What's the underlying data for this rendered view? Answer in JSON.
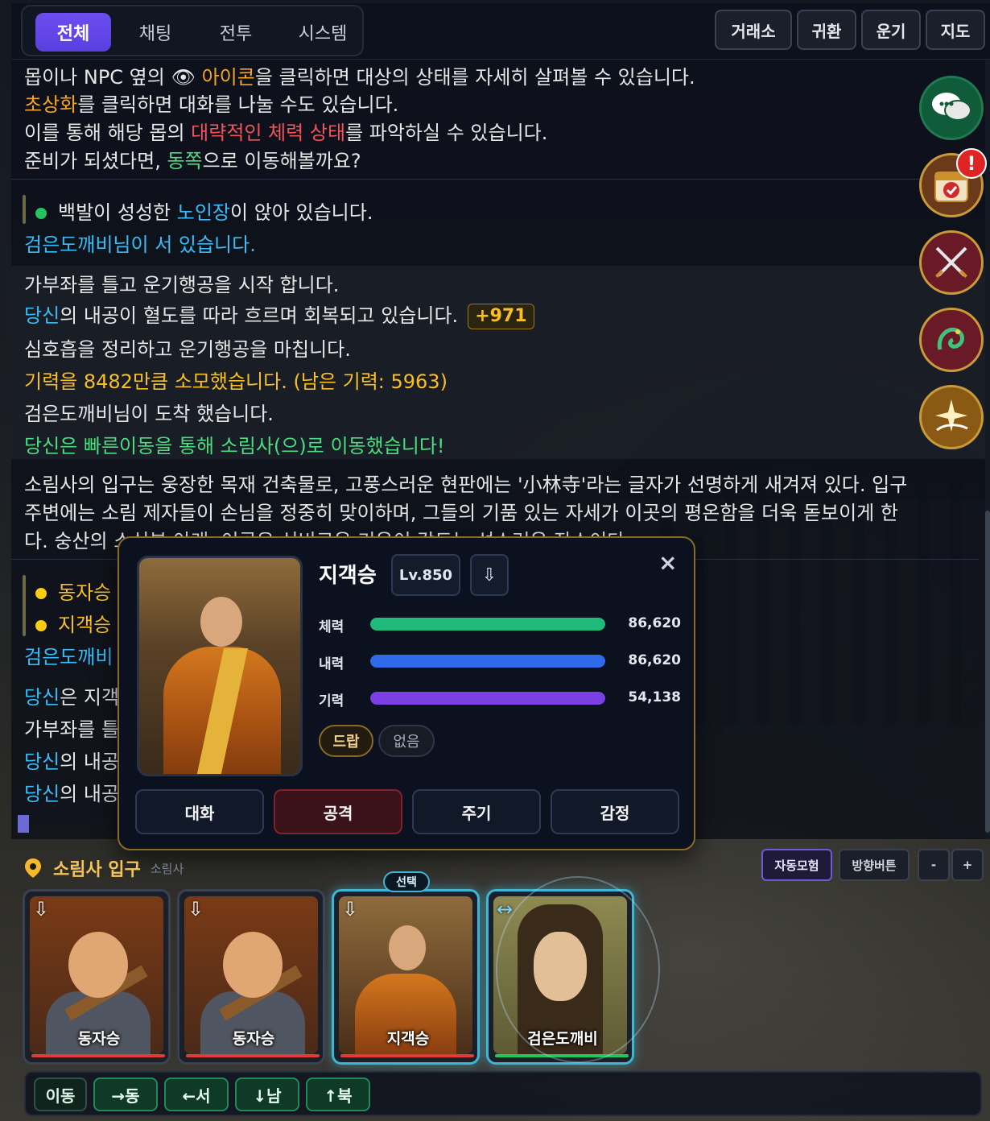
{
  "tabs": [
    "전체",
    "채팅",
    "전투",
    "시스템"
  ],
  "top_buttons": [
    "거래소",
    "귀환",
    "운기",
    "지도"
  ],
  "log": {
    "l1_pre": "몹이나 NPC 옆의 ",
    "l1_eye": "👁",
    "l1_hl": "아이콘",
    "l1_post": "을 클릭하면 대상의 상태를 자세히 살펴볼 수 있습니다.",
    "l2_hl": "초상화",
    "l2_post": "를 클릭하면 대화를 나눌 수도 있습니다.",
    "l3_pre": "이를 통해 해당 몹의 ",
    "l3_hl": "대략적인 체력 상태",
    "l3_post": "를 파악하실 수 있습니다.",
    "l4_pre": "준비가 되셨다면, ",
    "l4_hl": "동쪽",
    "l4_post": "으로 이동해볼까요?",
    "l5_pre": "백발이 성성한 ",
    "l5_hl": "노인장",
    "l5_post": "이 앉아 있습니다.",
    "l6": "검은도깨비님이 서 있습니다.",
    "l7": "가부좌를 틀고 운기행공을 시작 합니다.",
    "l8_hl": "당신",
    "l8_post": "의 내공이 혈도를 따라 흐르며 회복되고 있습니다.",
    "l8_badge": "+971",
    "l9": "심호흡을 정리하고 운기행공을 마칩니다.",
    "l10": "기력을 8482만큼 소모했습니다. (남은 기력: 5963)",
    "l11": "검은도깨비님이 도착 했습니다.",
    "l12": "당신은 빠른이동을 통해 소림사(으)로 이동했습니다!",
    "l13": "소림사의 입구는 웅장한 목재 건축물로, 고풍스러운 현판에는 '小林寺'라는 글자가 선명하게 새겨져 있다. 입구",
    "l14": "주변에는 소림 제자들이 손님을 정중히 맞이하며, 그들의 기품 있는 자세가 이곳의 평온함을 더욱 돋보이게 한",
    "l15": "다. 숭산의 소식본 아래, 이곳은 신비로운 기운이 감도는 성스러운 장소이다.",
    "l16": "동자승",
    "l17": "지객승",
    "l18": "검은도깨비",
    "l19_hl": "당신",
    "l19_post": "은 지객승",
    "l20": "가부좌를 틀",
    "l21_hl": "당신",
    "l21_post": "의 내공",
    "l22_hl": "당신",
    "l22_post": "의 내공"
  },
  "popup": {
    "name": "지객승",
    "level": "Lv.850",
    "stats": [
      {
        "label": "체력",
        "value": "86,620",
        "fraction": 1.0,
        "color": "#1fba7a"
      },
      {
        "label": "내력",
        "value": "86,620",
        "fraction": 1.0,
        "color": "#2f6be8"
      },
      {
        "label": "기력",
        "value": "54,138",
        "fraction": 1.0,
        "color": "#7b3fe4"
      }
    ],
    "chips": [
      "드랍",
      "없음"
    ],
    "actions": [
      "대화",
      "공격",
      "주기",
      "감정"
    ],
    "close": "×",
    "download_icon": "⇩"
  },
  "location": {
    "name": "소림사 입구",
    "sub": "소림사",
    "auto_label": "자동모험",
    "dir_label": "방향버튼",
    "minus": "-",
    "plus": "+"
  },
  "cards": [
    {
      "name": "동자승",
      "icon": "⇩",
      "hp_color": "#e03a3a"
    },
    {
      "name": "동자승",
      "icon": "⇩",
      "hp_color": "#e03a3a"
    },
    {
      "name": "지객승",
      "icon": "⇩",
      "hp_color": "#e03a3a"
    },
    {
      "name": "검은도깨비",
      "icon": "↔",
      "hp_color": "#22c55e"
    }
  ],
  "select_tag": "선택",
  "move": {
    "label": "이동",
    "buttons": [
      "→동",
      "←서",
      "↓남",
      "↑북"
    ]
  },
  "alert": "!"
}
